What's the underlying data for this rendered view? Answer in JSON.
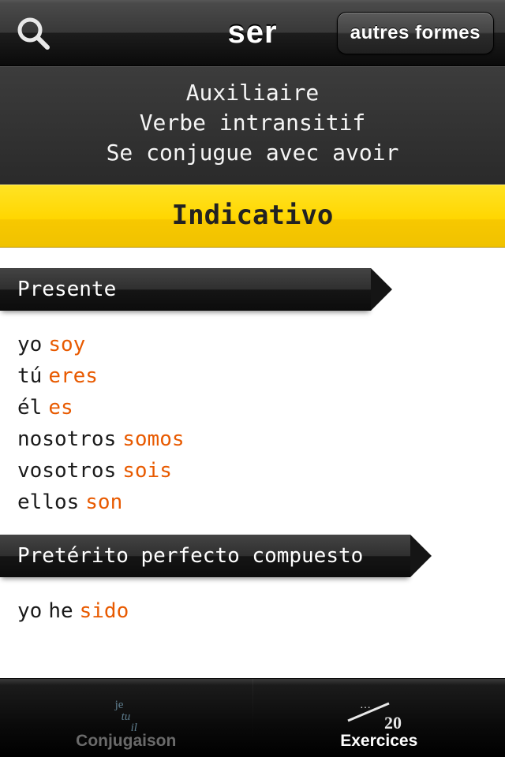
{
  "header": {
    "title": "ser",
    "other_forms": "autres formes"
  },
  "info": {
    "line1": "Auxiliaire",
    "line2": "Verbe intransitif",
    "line3": "Se conjugue avec avoir"
  },
  "mood": {
    "label": "Indicativo"
  },
  "tenses": [
    {
      "name": "Presente",
      "rows": [
        {
          "pronoun": "yo",
          "aux": "",
          "form": "soy"
        },
        {
          "pronoun": "tú",
          "aux": "",
          "form": "eres"
        },
        {
          "pronoun": "él",
          "aux": "",
          "form": "es"
        },
        {
          "pronoun": "nosotros",
          "aux": "",
          "form": "somos"
        },
        {
          "pronoun": "vosotros",
          "aux": "",
          "form": "sois"
        },
        {
          "pronoun": "ellos",
          "aux": "",
          "form": "son"
        }
      ]
    },
    {
      "name": "Pretérito perfecto compuesto",
      "rows": [
        {
          "pronoun": "yo",
          "aux": "he",
          "form": "sido"
        }
      ]
    }
  ],
  "tabs": {
    "conjugation": {
      "label": "Conjugaison",
      "icon_l1": "je",
      "icon_l2": "tu",
      "icon_l3": "il"
    },
    "exercises": {
      "label": "Exercices",
      "score_num": "…",
      "score_den": "20"
    }
  }
}
